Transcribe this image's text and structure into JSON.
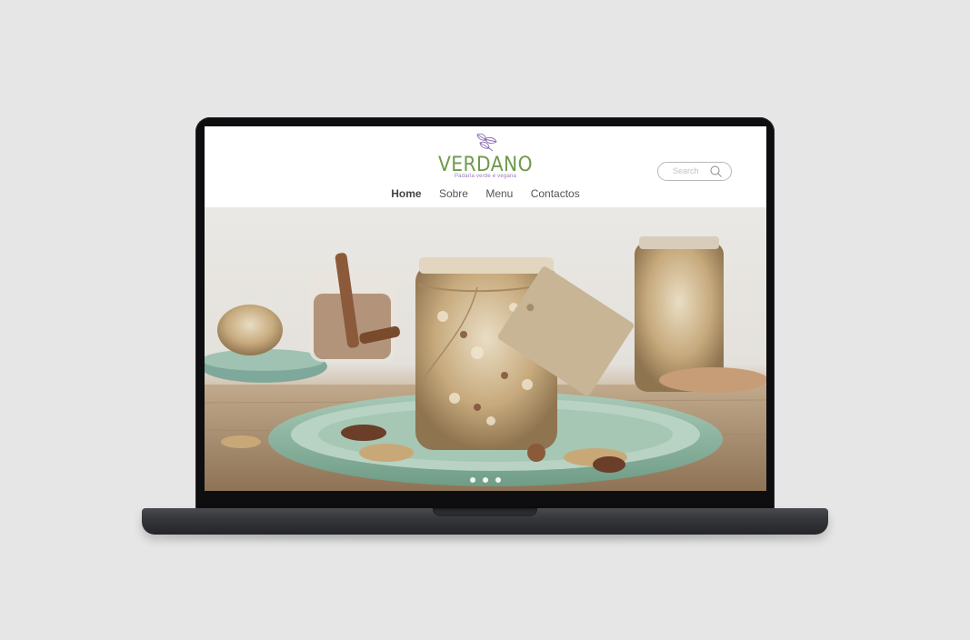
{
  "site": {
    "brand": "VERDANO",
    "tagline": "Padaria verde e vegana",
    "colors": {
      "brand_green": "#6e9a4c",
      "tagline_purple": "#9b7bb5",
      "icon_purple": "#8d6bb0"
    },
    "logo_icon": "leaf-icon"
  },
  "search": {
    "placeholder": "Search",
    "icon": "search-icon"
  },
  "nav": {
    "items": [
      {
        "label": "Home",
        "active": true
      },
      {
        "label": "Sobre",
        "active": false
      },
      {
        "label": "Menu",
        "active": false
      },
      {
        "label": "Contactos",
        "active": false
      }
    ]
  },
  "hero": {
    "image": "granola-jars-photo",
    "slides_total": 3,
    "slide_active": 2
  }
}
